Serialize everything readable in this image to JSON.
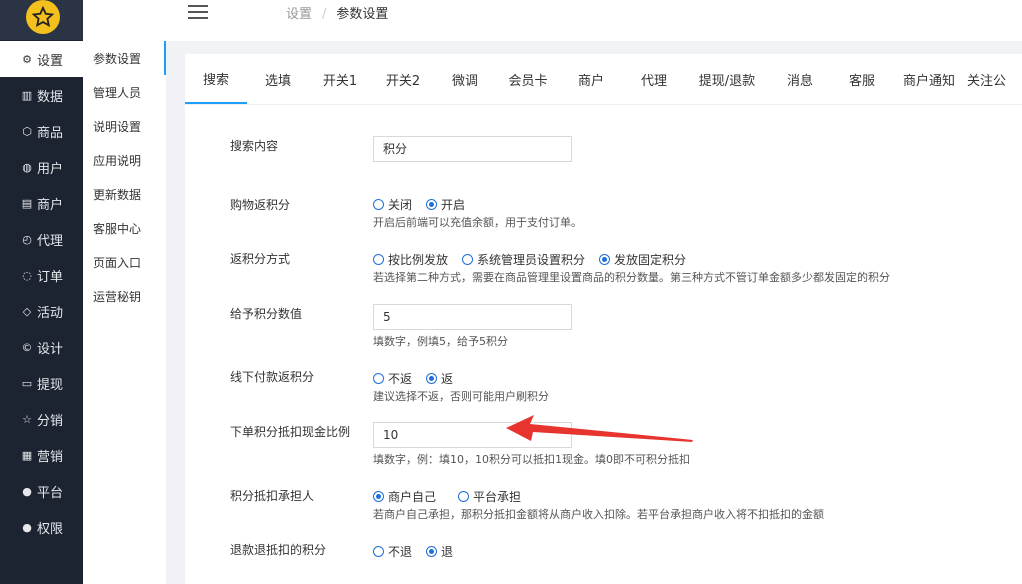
{
  "sidebar": {
    "items": [
      {
        "icon": "⚙",
        "label": "设置",
        "active": true
      },
      {
        "icon": "▥",
        "label": "数据"
      },
      {
        "icon": "⬡",
        "label": "商品"
      },
      {
        "icon": "◍",
        "label": "用户"
      },
      {
        "icon": "▤",
        "label": "商户"
      },
      {
        "icon": "◴",
        "label": "代理"
      },
      {
        "icon": "◌",
        "label": "订单"
      },
      {
        "icon": "◇",
        "label": "活动"
      },
      {
        "icon": "©",
        "label": "设计"
      },
      {
        "icon": "▭",
        "label": "提现"
      },
      {
        "icon": "☆",
        "label": "分销"
      },
      {
        "icon": "▦",
        "label": "营销"
      },
      {
        "icon": "●",
        "label": "平台"
      },
      {
        "icon": "●",
        "label": "权限"
      }
    ]
  },
  "subnav": {
    "items": [
      "参数设置",
      "管理人员",
      "说明设置",
      "应用说明",
      "更新数据",
      "客服中心",
      "页面入口",
      "运营秘钥"
    ]
  },
  "breadcrumb": {
    "root": "设置",
    "sep": "/",
    "current": "参数设置"
  },
  "tabs": [
    "搜索",
    "选填",
    "开关1",
    "开关2",
    "微调",
    "会员卡",
    "商户",
    "代理",
    "提现/退款",
    "消息",
    "客服",
    "商户通知",
    "关注公"
  ],
  "form": {
    "search": {
      "label": "搜索内容",
      "value": "积分"
    },
    "buy_points": {
      "label": "购物返积分",
      "options": [
        "关闭",
        "开启"
      ],
      "hint": "开启后前端可以充值余额，用于支付订单。"
    },
    "points_mode": {
      "label": "返积分方式",
      "options": [
        "按比例发放",
        "系统管理员设置积分",
        "发放固定积分"
      ],
      "hint": "若选择第二种方式，需要在商品管理里设置商品的积分数量。第三种方式不管订单金额多少都发固定的积分"
    },
    "points_value": {
      "label": "给予积分数值",
      "value": "5",
      "hint": "填数字，例填5，给予5积分"
    },
    "offline": {
      "label": "线下付款返积分",
      "options": [
        "不返",
        "返"
      ],
      "hint": "建议选择不返，否则可能用户刷积分"
    },
    "ratio": {
      "label": "下单积分抵扣现金比例",
      "value": "10",
      "hint": "填数字，例：填10，10积分可以抵扣1现金。填0即不可积分抵扣"
    },
    "bearer": {
      "label": "积分抵扣承担人",
      "options": [
        "商户自己",
        "平台承担"
      ],
      "hint": "若商户自己承担，那积分抵扣金额将从商户收入扣除。若平台承担商户收入将不扣抵扣的金额"
    },
    "refund": {
      "label": "退款退抵扣的积分",
      "options": [
        "不退",
        "退"
      ]
    }
  },
  "colors": {
    "accent": "#1e9fff",
    "arrow": "#e8342f",
    "sidebar": "#1c2331"
  }
}
